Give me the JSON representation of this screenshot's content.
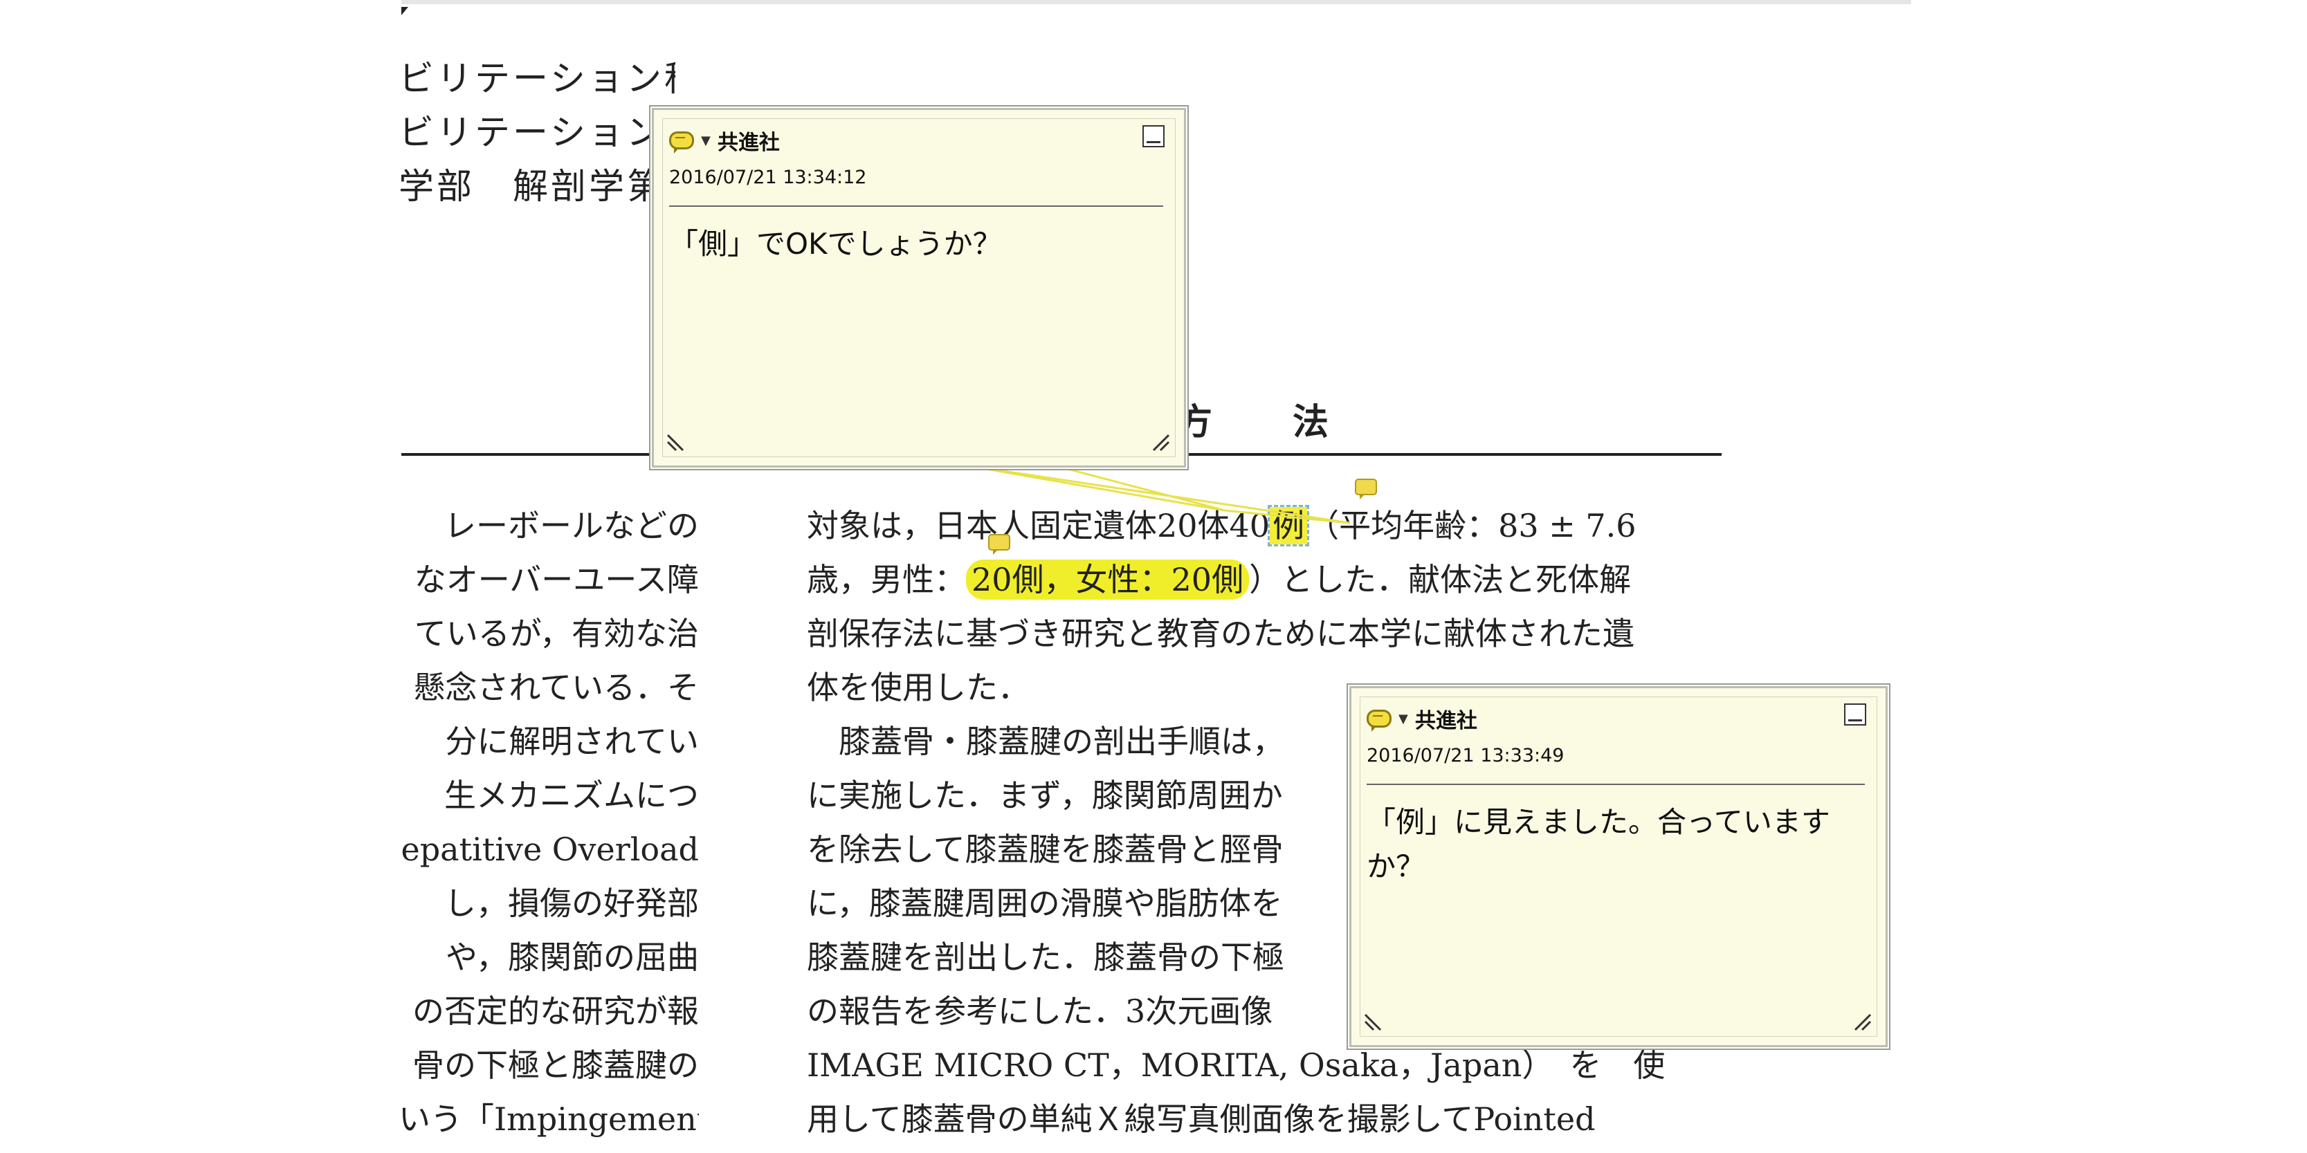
{
  "affiliations": [
    "ビリテーション科",
    "ビリテーション",
    "学部　解剖学第"
  ],
  "section_heading": "方　　法",
  "left_column_lines": [
    "レーボールなどの",
    "なオーバーユース障",
    "ているが，有効な治",
    "懸念されている．そ",
    "分に解明されてい",
    "生メカニズムにつ",
    "epatitive Overload",
    "し，損傷の好発部",
    "や，膝関節の屈曲",
    "の否定的な研究が報",
    "骨の下極と膝蓋腱の",
    "いう「Impingement"
  ],
  "right_column": {
    "line1": {
      "pre": "対象は，日本人固定遺体20体40",
      "highlight": "例",
      "post": "（平均年齢：83 ± 7.6"
    },
    "line2": {
      "pre": "歳，男性：",
      "highlight": "20側，女性：20側",
      "post": "）とした．献体法と死体解"
    },
    "lines_rest": [
      "剖保存法に基づき研究と教育のために本学に献体された遺",
      "体を使用した．",
      "　膝蓋骨・膝蓋腱の剖出手順は，",
      "に実施した．まず，膝関節周囲か",
      "を除去して膝蓋腱を膝蓋骨と脛骨",
      "に，膝蓋腱周囲の滑膜や脂肪体を",
      "膝蓋腱を剖出した．膝蓋骨の下極",
      "の報告を参考にした．3次元画像",
      "IMAGE MICRO CT，MORITA, Osaka，Japan）　を　使",
      "用して膝蓋骨の単純Ｘ線写真側面像を撮影してPointed"
    ]
  },
  "comments": [
    {
      "author": "共進社",
      "date": "2016/07/21 13:34:12",
      "text": "「側」でOKでしょうか？"
    },
    {
      "author": "共進社",
      "date": "2016/07/21 13:33:49",
      "text": "「例」に見えました。合っていますか？"
    }
  ],
  "colors": {
    "highlight": "#f0ee2a",
    "note_background": "#fbfbe6",
    "connector": "#e8e24a"
  }
}
